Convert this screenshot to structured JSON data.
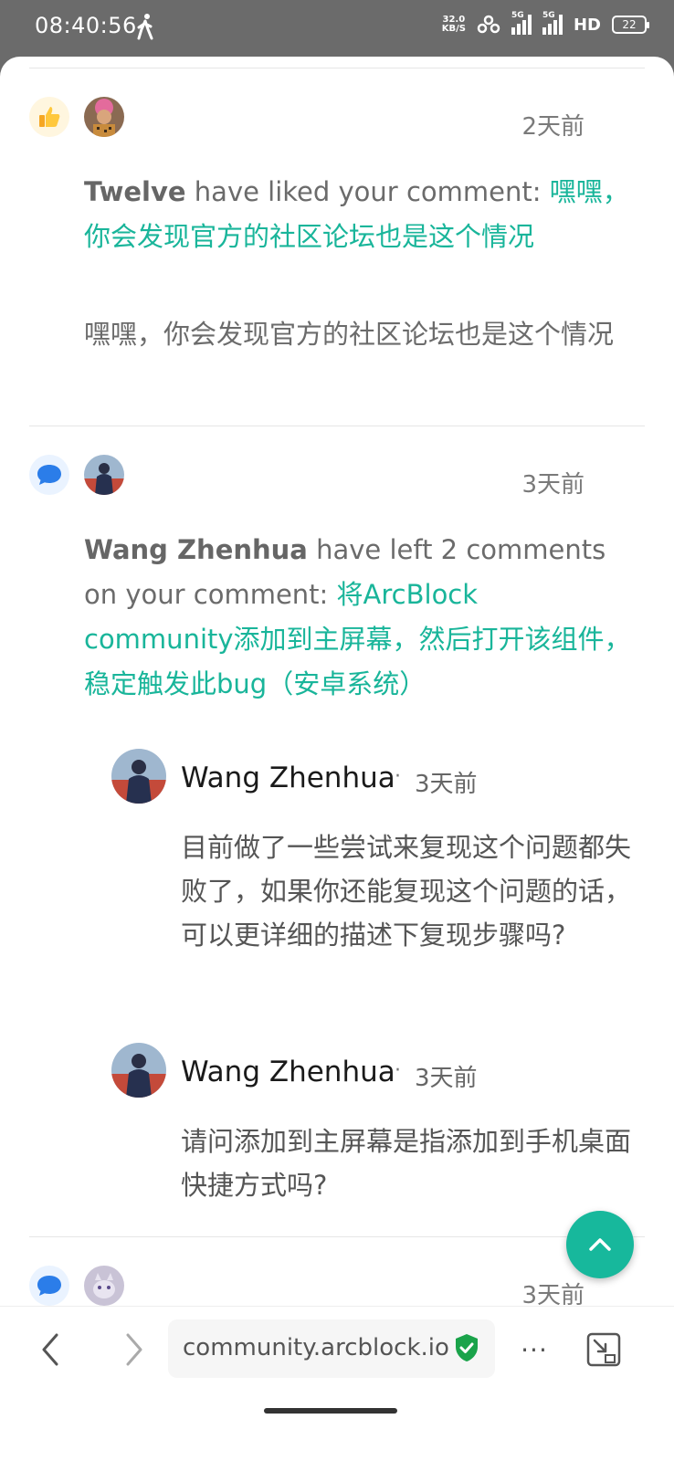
{
  "status_bar": {
    "time": "08:40:56",
    "net_speed_value": "32.0",
    "net_speed_unit": "KB/S",
    "sig1_label": "5G",
    "sig2_label": "5G",
    "hd_label": "HD",
    "battery": "22"
  },
  "notifications": [
    {
      "type": "like",
      "time_ago": "2天前",
      "actor": "Twelve",
      "action": " have liked your comment: ",
      "link": "嘿嘿，你会发现官方的社区论坛也是这个情况",
      "quote": "嘿嘿，你会发现官方的社区论坛也是这个情况"
    },
    {
      "type": "comment",
      "time_ago": "3天前",
      "actor": "Wang Zhenhua",
      "action": " have left 2 comments on your comment: ",
      "link": "将ArcBlock community添加到主屏幕，然后打开该组件，稳定触发此bug（安卓系统）",
      "replies": [
        {
          "name": "Wang Zhenhua",
          "dot": "·",
          "time_ago": "3天前",
          "text": "目前做了一些尝试来复现这个问题都失败了，如果你还能复现这个问题的话，可以更详细的描述下复现步骤吗?"
        },
        {
          "name": "Wang Zhenhua",
          "dot": "·",
          "time_ago": "3天前",
          "text": "请问添加到主屏幕是指添加到手机桌面快捷方式吗?"
        }
      ]
    },
    {
      "type": "comment",
      "time_ago": "3天前"
    }
  ],
  "browser": {
    "url": "community.arcblock.io",
    "more_label": "···"
  },
  "colors": {
    "accent": "#19b59a",
    "fab": "#17b89c",
    "comment_icon": "#2b7de9",
    "secure_shield": "#1aa34a"
  }
}
